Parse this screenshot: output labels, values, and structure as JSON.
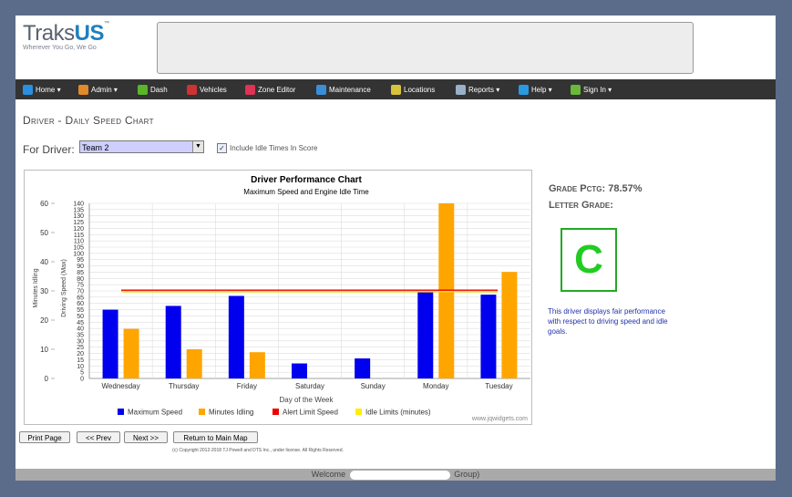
{
  "brand": {
    "name_light": "Traks",
    "name_bold": "US",
    "tm": "™",
    "tagline": "Wherever You Go, We Go"
  },
  "nav": {
    "items": [
      {
        "label": "Home ▾",
        "icon": "home-icon",
        "color": "#2a8fe0"
      },
      {
        "label": "Admin ▾",
        "icon": "admin-icon",
        "color": "#e08a2a"
      },
      {
        "label": "Dash",
        "icon": "dash-icon",
        "color": "#5ab52a"
      },
      {
        "label": "Vehicles",
        "icon": "vehicles-icon",
        "color": "#cc3333"
      },
      {
        "label": "Zone Editor",
        "icon": "zone-icon",
        "color": "#dd3355"
      },
      {
        "label": "Maintenance",
        "icon": "maintenance-icon",
        "color": "#3a8ed8"
      },
      {
        "label": "Locations",
        "icon": "locations-icon",
        "color": "#d8c23a"
      },
      {
        "label": "Reports ▾",
        "icon": "reports-icon",
        "color": "#9ab0c8"
      },
      {
        "label": "Help ▾",
        "icon": "help-icon",
        "color": "#2a9ae0"
      },
      {
        "label": "Sign In ▾",
        "icon": "signin-icon",
        "color": "#6ab83a"
      }
    ]
  },
  "page": {
    "title": "Driver - Daily Speed Chart",
    "driver_label": "For Driver:",
    "driver_value": "Team 2",
    "idle_checkbox_label": "Include Idle Times In Score",
    "idle_checkbox_checked": true
  },
  "chart_data": {
    "type": "bar",
    "title": "Driver Performance Chart",
    "subtitle": "Maximum Speed and Engine Idle Time",
    "xlabel": "Day of the Week",
    "ylabel_left": "Minutes Idling",
    "ylabel_inner": "Driving Speed (Max)",
    "categories": [
      "Wednesday",
      "Thursday",
      "Friday",
      "Saturday",
      "Sunday",
      "Monday",
      "Tuesday"
    ],
    "speed_axis": {
      "min": 0,
      "max": 140,
      "step": 5
    },
    "idle_axis": {
      "min": 0,
      "max": 60,
      "step": 10
    },
    "series": [
      {
        "name": "Maximum Speed",
        "color": "#0000ee",
        "axis": "speed",
        "values": [
          55,
          58,
          66,
          12,
          16,
          70,
          67
        ]
      },
      {
        "name": "Minutes Idling",
        "color": "#ffa500",
        "axis": "idle",
        "values": [
          17,
          10,
          9,
          0,
          0,
          60,
          36.5
        ]
      }
    ],
    "alert_limit_speed": 70,
    "idle_limit_minutes": 30,
    "legend": [
      {
        "label": "Maximum Speed",
        "color": "#0000ee"
      },
      {
        "label": "Minutes Idling",
        "color": "#ffa500"
      },
      {
        "label": "Alert Limit Speed",
        "color": "#ee0000"
      },
      {
        "label": "Idle Limits (minutes)",
        "color": "#ffee00"
      }
    ],
    "credit": "www.jqwidgets.com",
    "grid": true,
    "legend_position": "bottom"
  },
  "grade": {
    "pct_label": "Grade Pctg:",
    "pct_value": "78.57%",
    "letter_label": "Letter Grade:",
    "letter": "C",
    "description": "This driver displays fair performance with respect to driving speed and idle goals."
  },
  "buttons": {
    "print": "Print Page",
    "prev": "<< Prev",
    "next": "Next >>",
    "main_map": "Return to Main Map"
  },
  "copyright": "(c) Copyright 2012-2018 TJ Powell and DTS Inc., under license. All Rights Reserved.",
  "footer": {
    "welcome": "Welcome",
    "group_suffix": "Group)"
  }
}
